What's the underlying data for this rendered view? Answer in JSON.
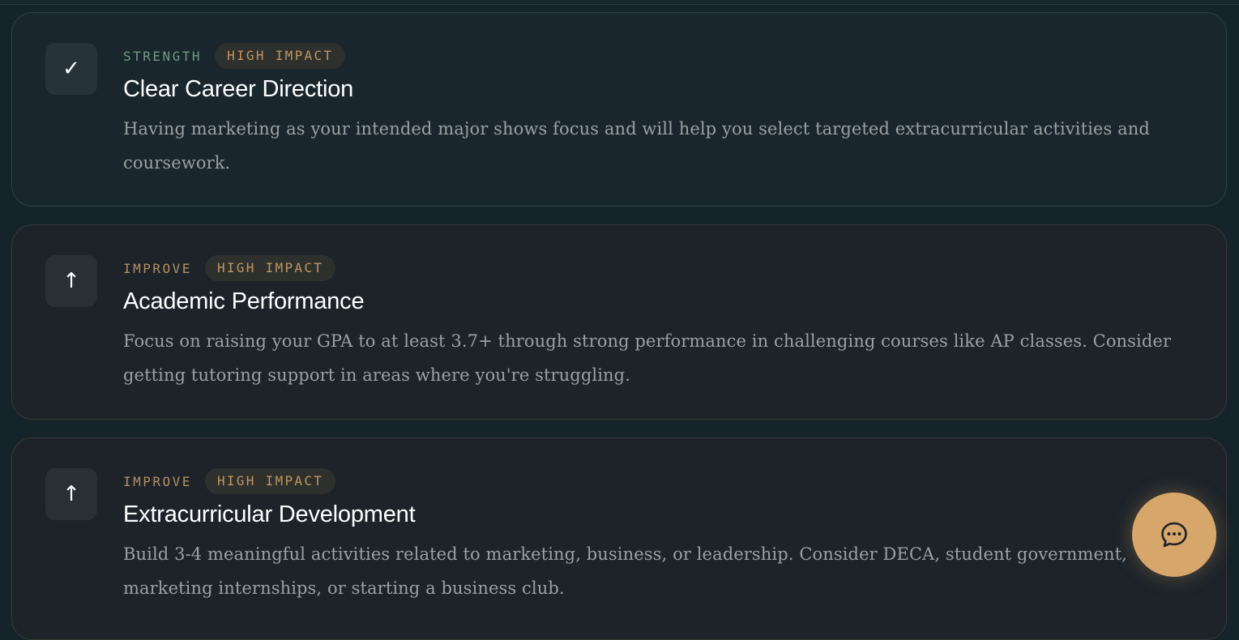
{
  "colors": {
    "background": "#15232a",
    "strength_label": "#6f9a82",
    "improve_label": "#b48f64",
    "impact_badge_text": "#c4955e",
    "chat_button": "#d7a66b"
  },
  "cards": [
    {
      "kind": "STRENGTH",
      "impact": "HIGH IMPACT",
      "icon": "check-icon",
      "icon_glyph": "✓",
      "title": "Clear Career Direction",
      "description": "Having marketing as your intended major shows focus and will help you select targeted extracurricular activities and coursework."
    },
    {
      "kind": "IMPROVE",
      "impact": "HIGH IMPACT",
      "icon": "arrow-up-icon",
      "icon_glyph": "↑",
      "title": "Academic Performance",
      "description": "Focus on raising your GPA to at least 3.7+ through strong performance in challenging courses like AP classes. Consider getting tutoring support in areas where you're struggling."
    },
    {
      "kind": "IMPROVE",
      "impact": "HIGH IMPACT",
      "icon": "arrow-up-icon",
      "icon_glyph": "↑",
      "title": "Extracurricular Development",
      "description": "Build 3-4 meaningful activities related to marketing, business, or leadership. Consider DECA, student government, marketing internships, or starting a business club."
    }
  ],
  "chat_button": {
    "icon": "chat-bubble-icon"
  }
}
